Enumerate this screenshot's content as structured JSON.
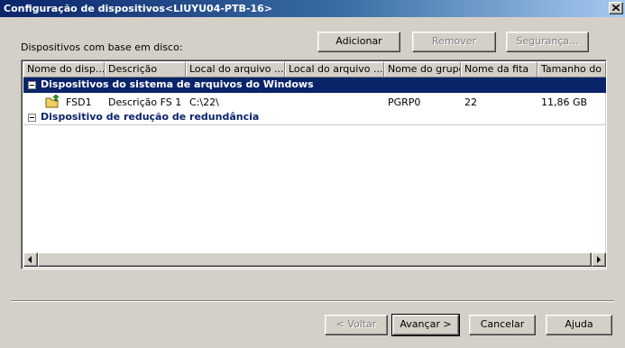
{
  "window": {
    "title": "Configuração de dispositivos<LIUYU04-PTB-16>"
  },
  "disks_label": "Dispositivos com base em disco:",
  "toolbar": {
    "add": "Adicionar",
    "remove": "Remover",
    "security": "Segurança..."
  },
  "columns": [
    "Nome do disp...",
    "Descrição",
    "Local do arquivo ...",
    "Local do arquivo ...",
    "Nome do grupo",
    "Nome da fita",
    "Tamanho do vo"
  ],
  "groups": [
    {
      "label": "Dispositivos do sistema de arquivos do Windows",
      "selected": true,
      "items": [
        {
          "device_name": "FSD1",
          "description": "Descrição FS 1",
          "file_location": "C:\\22\\",
          "file_location_2": "",
          "group_name": "PGRP0",
          "tape_name": "22",
          "volume_size": "11,86 GB"
        }
      ]
    },
    {
      "label": "Dispositivo de redução de redundância",
      "selected": false,
      "items": []
    }
  ],
  "footer": {
    "back": "< Voltar",
    "next": "Avançar >",
    "cancel": "Cancelar",
    "help": "Ajuda"
  },
  "icons": {
    "close": "close-icon",
    "device": "folder-device-icon",
    "scroll_left": "arrow-left-icon",
    "scroll_right": "arrow-right-icon"
  },
  "colors": {
    "title_bar": "#0a246a",
    "selection": "#0a246a",
    "face": "#d4d0c8"
  }
}
